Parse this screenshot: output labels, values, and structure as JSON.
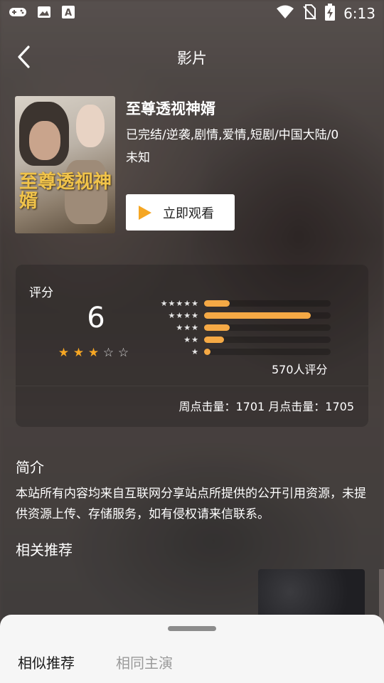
{
  "status_bar": {
    "time": "6:13",
    "left_icons": [
      "gamepad-icon",
      "image-icon",
      "a-icon"
    ],
    "right_icons": [
      "wifi-icon",
      "no-sim-icon",
      "battery-charging-icon"
    ]
  },
  "header": {
    "title": "影片",
    "back_icon": "chevron-left-icon"
  },
  "movie": {
    "poster_logo": "至尊透视神婿",
    "name": "至尊透视神婿",
    "meta": "已完结/逆袭,剧情,爱情,短剧/中国大陆/0",
    "status": "未知",
    "watch_button": "立即观看"
  },
  "rating": {
    "label": "评分",
    "score": "6",
    "stars": 3,
    "stars_max": 5,
    "distribution": [
      {
        "stars": "★★★★★",
        "fraction": 0.2
      },
      {
        "stars": "★★★★",
        "fraction": 0.84
      },
      {
        "stars": "★★★",
        "fraction": 0.2
      },
      {
        "stars": "★★",
        "fraction": 0.16
      },
      {
        "stars": "★",
        "fraction": 0.05
      }
    ],
    "count": "570人评分",
    "clicks": "周点击量：1701  月点击量：1705"
  },
  "intro": {
    "title": "简介",
    "text": "本站所有内容均来自互联网分享站点所提供的公开引用资源，未提供资源上传、存储服务，如有侵权请来信联系。"
  },
  "related": {
    "title": "相关推荐"
  },
  "sheet": {
    "tabs": [
      "相似推荐",
      "相同主演"
    ],
    "active_tab": 0
  },
  "colors": {
    "accent": "#f5a623",
    "bar": "#f5a945"
  }
}
